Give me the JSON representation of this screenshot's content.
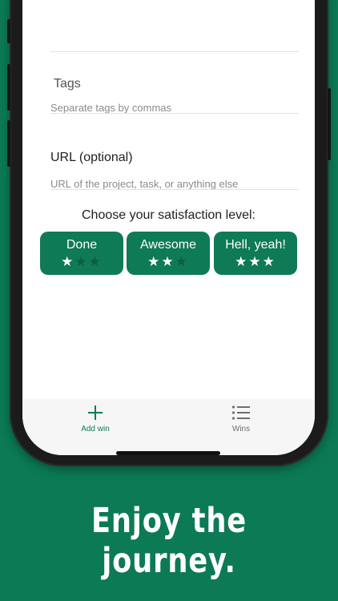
{
  "form": {
    "tags_label": "Tags",
    "tags_placeholder": "Separate tags by commas",
    "url_label": "URL (optional)",
    "url_placeholder": "URL of the project, task, or anything else"
  },
  "satisfaction": {
    "prompt": "Choose your satisfaction level:",
    "options": [
      {
        "label": "Done",
        "stars_filled": 1,
        "stars_total": 3
      },
      {
        "label": "Awesome",
        "stars_filled": 2,
        "stars_total": 3
      },
      {
        "label": "Hell, yeah!",
        "stars_filled": 3,
        "stars_total": 3
      }
    ]
  },
  "tabbar": {
    "add_win_label": "Add win",
    "wins_label": "Wins"
  },
  "promo": {
    "tagline": "Enjoy the journey."
  },
  "colors": {
    "brand_green": "#0b7a55",
    "tab_active": "#0e7a56",
    "tab_inactive": "#6e6e6e"
  },
  "icons": {
    "add_win": "plus-icon",
    "wins": "list-icon",
    "star": "star-icon"
  }
}
